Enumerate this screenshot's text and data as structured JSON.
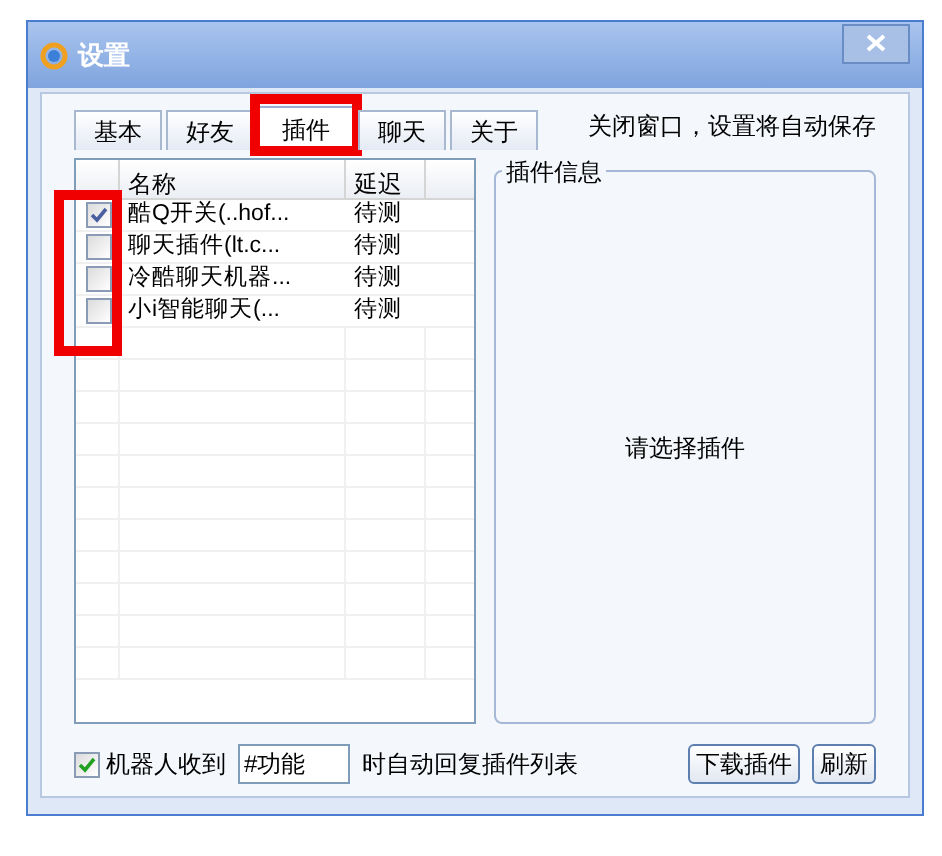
{
  "window": {
    "title": "设置"
  },
  "tabs": [
    {
      "label": "基本",
      "selected": false
    },
    {
      "label": "好友",
      "selected": false
    },
    {
      "label": "插件",
      "selected": true
    },
    {
      "label": "聊天",
      "selected": false
    },
    {
      "label": "关于",
      "selected": false
    }
  ],
  "notice": "关闭窗口，设置将自动保存",
  "plugin_list": {
    "columns": [
      "名称",
      "延迟"
    ],
    "rows": [
      {
        "checked": true,
        "name": "酷Q开关(..hof...",
        "delay": "待测"
      },
      {
        "checked": false,
        "name": "聊天插件(lt.c...",
        "delay": "待测"
      },
      {
        "checked": false,
        "name": "冷酷聊天机器...",
        "delay": "待测"
      },
      {
        "checked": false,
        "name": "小i智能聊天(...",
        "delay": "待测"
      }
    ]
  },
  "info_panel": {
    "title": "插件信息",
    "message": "请选择插件"
  },
  "auto_reply": {
    "checked": true,
    "label": "机器人收到",
    "value": "#功能",
    "suffix": "时自动回复插件列表"
  },
  "buttons": [
    "下载插件",
    "刷新"
  ]
}
